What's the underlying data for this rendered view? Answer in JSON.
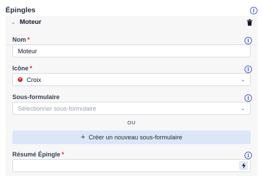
{
  "header": {
    "title": "Épingles",
    "info_icon": "info-icon"
  },
  "panel": {
    "title": "Moteur",
    "chevron_icon": "chevron-down-icon",
    "delete_icon": "trash-icon"
  },
  "fields": {
    "nom": {
      "label": "Nom",
      "required_mark": "*",
      "value": "Moteur"
    },
    "icone": {
      "label": "Icône",
      "required_mark": "*",
      "value": "Croix",
      "value_icon": "x-circle-icon"
    },
    "sous_formulaire": {
      "label": "Sous-formulaire",
      "placeholder": "Sélectionner sous-formulaire"
    },
    "separator": "OU",
    "create_button": {
      "icon": "+",
      "label": "Créer un nouveau sous-formulaire"
    },
    "resume": {
      "label": "Résumé Épingle",
      "required_mark": "*",
      "value": "",
      "action_icon": "lightning-bolt-icon"
    }
  },
  "colors": {
    "accent": "#4f62c9",
    "required": "#dc2626",
    "button_bg": "#dce6f9",
    "panel_bg": "#f7f7f8"
  }
}
